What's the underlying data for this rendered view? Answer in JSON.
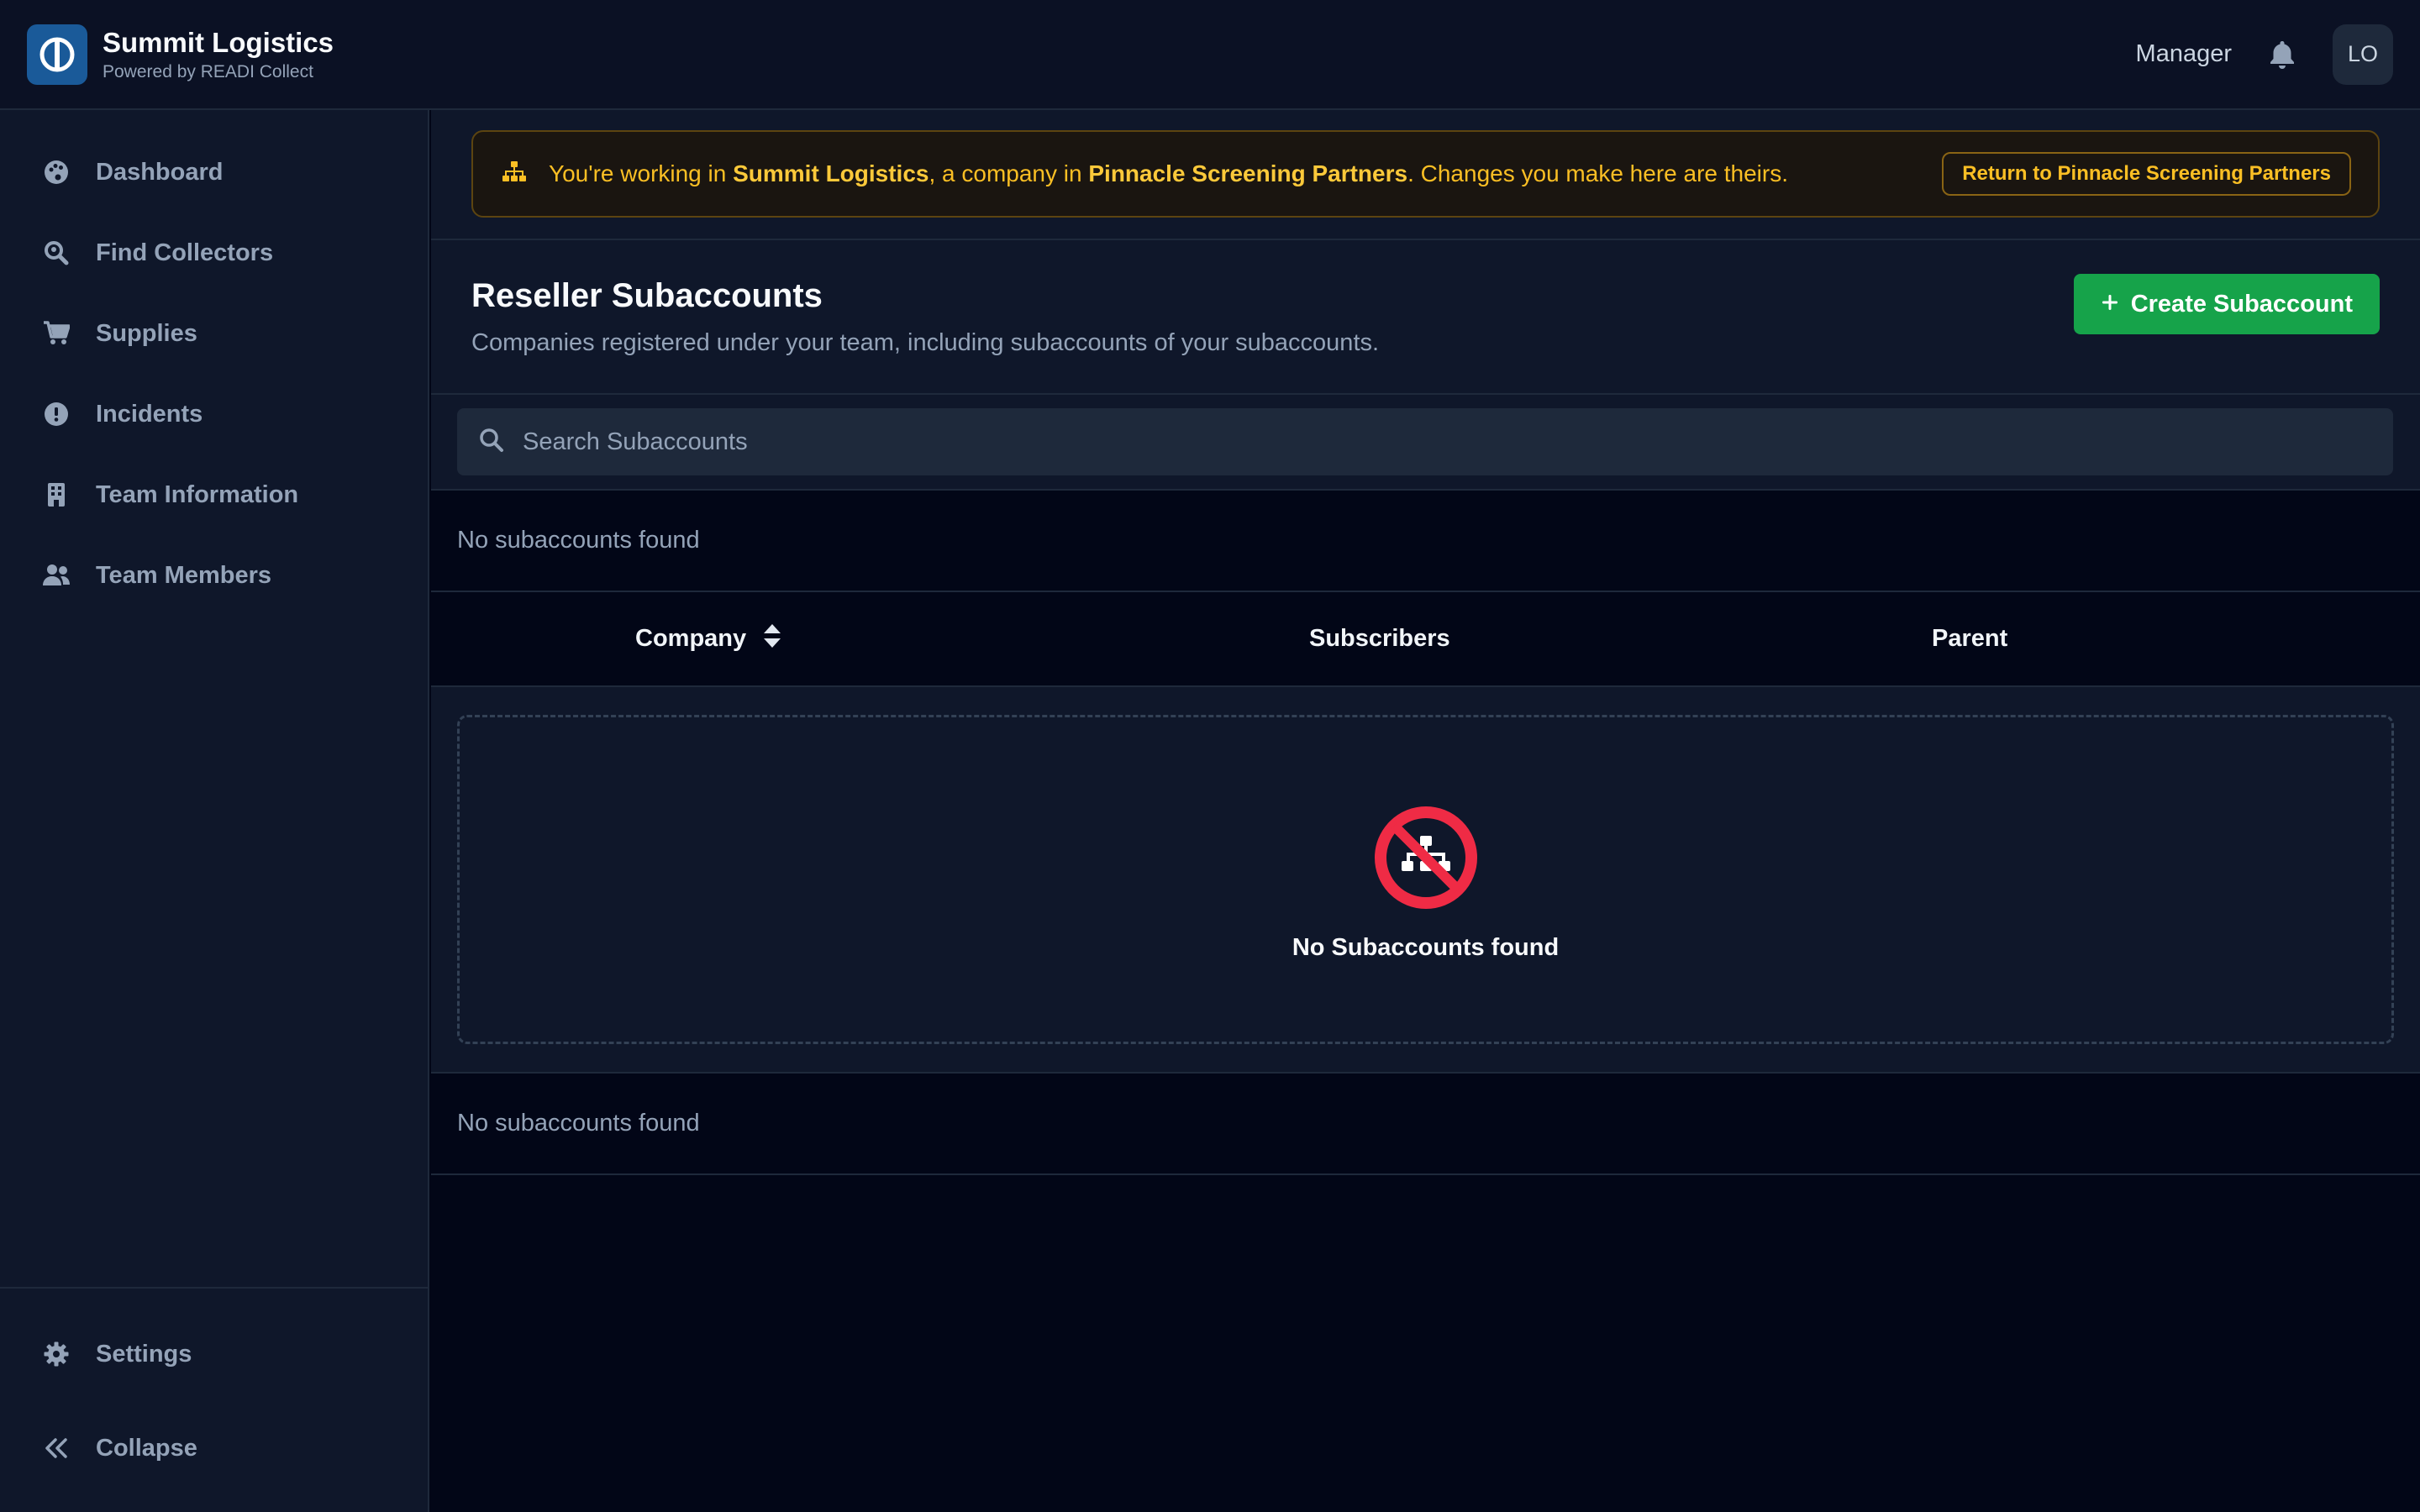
{
  "header": {
    "brand_name": "Summit Logistics",
    "brand_sub": "Powered by READI Collect",
    "role": "Manager",
    "avatar_initials": "LO"
  },
  "sidebar": {
    "items": [
      {
        "label": "Dashboard",
        "icon": "palette-icon"
      },
      {
        "label": "Find Collectors",
        "icon": "search-location-icon"
      },
      {
        "label": "Supplies",
        "icon": "cart-icon"
      },
      {
        "label": "Incidents",
        "icon": "exclamation-circle-icon"
      },
      {
        "label": "Team Information",
        "icon": "building-icon"
      },
      {
        "label": "Team Members",
        "icon": "users-icon"
      }
    ],
    "settings_label": "Settings",
    "collapse_label": "Collapse"
  },
  "banner": {
    "prefix": "You're working in ",
    "company": "Summit Logistics",
    "middle": ", a company in ",
    "parent": "Pinnacle Screening Partners",
    "suffix": ". Changes you make here are theirs.",
    "return_label": "Return to Pinnacle Screening Partners"
  },
  "page": {
    "title": "Reseller Subaccounts",
    "subtitle": "Companies registered under your team, including subaccounts of your subaccounts.",
    "create_label": "Create Subaccount"
  },
  "search": {
    "placeholder": "Search Subaccounts",
    "value": ""
  },
  "table": {
    "top_status": "No subaccounts found",
    "columns": [
      "Company",
      "Subscribers",
      "Parent"
    ],
    "empty_title": "No Subaccounts found",
    "bottom_status": "No subaccounts found"
  },
  "colors": {
    "accent_green": "#16a34a",
    "warning_amber": "#fbbf24",
    "empty_red": "#ef2b45",
    "brand_blue": "#1a5a99"
  }
}
